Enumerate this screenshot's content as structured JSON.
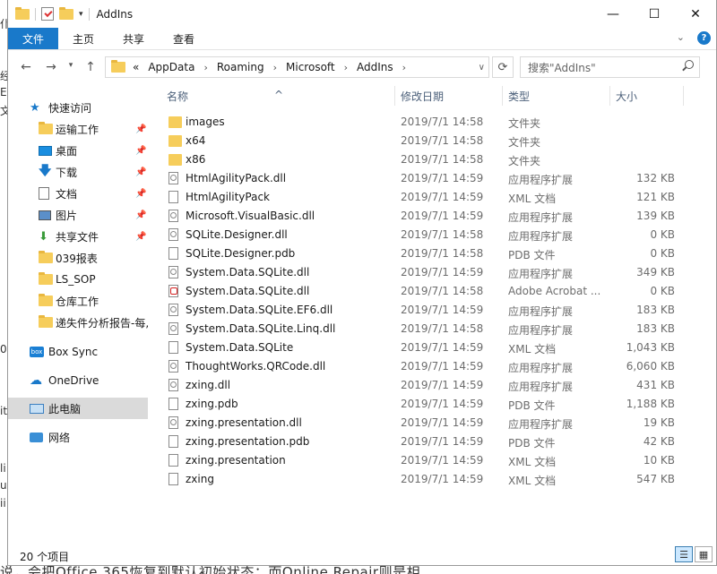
{
  "window": {
    "title": "AddIns",
    "controls": {
      "minimize": "—",
      "maximize": "☐",
      "close": "✕"
    }
  },
  "ribbon": {
    "tabs": [
      "文件",
      "主页",
      "共享",
      "查看"
    ]
  },
  "address": {
    "prefix": "«",
    "crumbs": [
      "AppData",
      "Roaming",
      "Microsoft",
      "AddIns"
    ],
    "search_placeholder": "搜索\"AddIns\""
  },
  "sidebar": {
    "items": [
      {
        "label": "快速访问",
        "icon": "star-icon",
        "pinned": false
      },
      {
        "label": "运输工作",
        "icon": "folder-icon",
        "pinned": true
      },
      {
        "label": "桌面",
        "icon": "desktop-icon",
        "pinned": true
      },
      {
        "label": "下载",
        "icon": "download-icon",
        "pinned": true
      },
      {
        "label": "文档",
        "icon": "document-icon",
        "pinned": true
      },
      {
        "label": "图片",
        "icon": "pictures-icon",
        "pinned": true
      },
      {
        "label": "共享文件",
        "icon": "shared-folder-icon",
        "pinned": true
      },
      {
        "label": "039报表",
        "icon": "folder-icon",
        "pinned": false
      },
      {
        "label": "LS_SOP",
        "icon": "folder-icon",
        "pinned": false
      },
      {
        "label": "仓库工作",
        "icon": "folder-icon",
        "pinned": false
      },
      {
        "label": "递失件分析报告-每,",
        "icon": "folder-icon",
        "pinned": false
      },
      {
        "label": "Box Sync",
        "icon": "box-icon",
        "pinned": false
      },
      {
        "label": "OneDrive",
        "icon": "cloud-icon",
        "pinned": false
      },
      {
        "label": "此电脑",
        "icon": "computer-icon",
        "pinned": false,
        "selected": true
      },
      {
        "label": "网络",
        "icon": "network-icon",
        "pinned": false
      }
    ]
  },
  "columns": [
    "名称",
    "修改日期",
    "类型",
    "大小"
  ],
  "files": [
    {
      "name": "images",
      "date": "2019/7/1 14:58",
      "type": "文件夹",
      "size": "",
      "icon": "folder"
    },
    {
      "name": "x64",
      "date": "2019/7/1 14:58",
      "type": "文件夹",
      "size": "",
      "icon": "folder"
    },
    {
      "name": "x86",
      "date": "2019/7/1 14:58",
      "type": "文件夹",
      "size": "",
      "icon": "folder"
    },
    {
      "name": "HtmlAgilityPack.dll",
      "date": "2019/7/1 14:59",
      "type": "应用程序扩展",
      "size": "132 KB",
      "icon": "dll"
    },
    {
      "name": "HtmlAgilityPack",
      "date": "2019/7/1 14:59",
      "type": "XML 文档",
      "size": "121 KB",
      "icon": "file"
    },
    {
      "name": "Microsoft.VisualBasic.dll",
      "date": "2019/7/1 14:59",
      "type": "应用程序扩展",
      "size": "139 KB",
      "icon": "dll"
    },
    {
      "name": "SQLite.Designer.dll",
      "date": "2019/7/1 14:58",
      "type": "应用程序扩展",
      "size": "0 KB",
      "icon": "dll"
    },
    {
      "name": "SQLite.Designer.pdb",
      "date": "2019/7/1 14:58",
      "type": "PDB 文件",
      "size": "0 KB",
      "icon": "file"
    },
    {
      "name": "System.Data.SQLite.dll",
      "date": "2019/7/1 14:59",
      "type": "应用程序扩展",
      "size": "349 KB",
      "icon": "dll"
    },
    {
      "name": "System.Data.SQLite.dll",
      "date": "2019/7/1 14:58",
      "type": "Adobe Acrobat ...",
      "size": "0 KB",
      "icon": "pdf"
    },
    {
      "name": "System.Data.SQLite.EF6.dll",
      "date": "2019/7/1 14:59",
      "type": "应用程序扩展",
      "size": "183 KB",
      "icon": "dll"
    },
    {
      "name": "System.Data.SQLite.Linq.dll",
      "date": "2019/7/1 14:58",
      "type": "应用程序扩展",
      "size": "183 KB",
      "icon": "dll"
    },
    {
      "name": "System.Data.SQLite",
      "date": "2019/7/1 14:59",
      "type": "XML 文档",
      "size": "1,043 KB",
      "icon": "file"
    },
    {
      "name": "ThoughtWorks.QRCode.dll",
      "date": "2019/7/1 14:59",
      "type": "应用程序扩展",
      "size": "6,060 KB",
      "icon": "dll"
    },
    {
      "name": "zxing.dll",
      "date": "2019/7/1 14:59",
      "type": "应用程序扩展",
      "size": "431 KB",
      "icon": "dll"
    },
    {
      "name": "zxing.pdb",
      "date": "2019/7/1 14:59",
      "type": "PDB 文件",
      "size": "1,188 KB",
      "icon": "file"
    },
    {
      "name": "zxing.presentation.dll",
      "date": "2019/7/1 14:59",
      "type": "应用程序扩展",
      "size": "19 KB",
      "icon": "dll"
    },
    {
      "name": "zxing.presentation.pdb",
      "date": "2019/7/1 14:59",
      "type": "PDB 文件",
      "size": "42 KB",
      "icon": "file"
    },
    {
      "name": "zxing.presentation",
      "date": "2019/7/1 14:59",
      "type": "XML 文档",
      "size": "10 KB",
      "icon": "file"
    },
    {
      "name": "zxing",
      "date": "2019/7/1 14:59",
      "type": "XML 文档",
      "size": "547 KB",
      "icon": "file"
    }
  ],
  "status": {
    "count": "20 个项目"
  },
  "background": {
    "bottom_text": "说，会把Office 365恢复到默认初始状态；而Online Repair则是相",
    "left_chars": [
      "仆",
      "经",
      "E",
      "文",
      "0",
      "it",
      "li",
      "u",
      "ii"
    ]
  }
}
